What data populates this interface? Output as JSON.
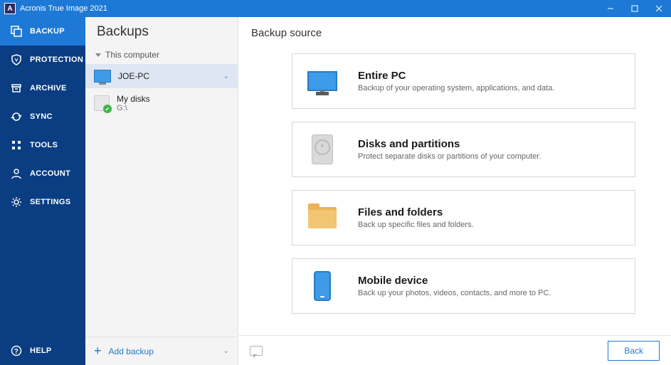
{
  "window": {
    "title": "Acronis True Image 2021",
    "logo_letter": "A"
  },
  "nav": {
    "items": [
      {
        "id": "backup",
        "label": "BACKUP"
      },
      {
        "id": "protection",
        "label": "PROTECTION"
      },
      {
        "id": "archive",
        "label": "ARCHIVE"
      },
      {
        "id": "sync",
        "label": "SYNC"
      },
      {
        "id": "tools",
        "label": "TOOLS"
      },
      {
        "id": "account",
        "label": "ACCOUNT"
      },
      {
        "id": "settings",
        "label": "SETTINGS"
      }
    ],
    "help_label": "HELP"
  },
  "panel": {
    "header": "Backups",
    "group_label": "This computer",
    "backups": [
      {
        "name": "JOE-PC",
        "sub": null,
        "selected": true,
        "icon": "monitor"
      },
      {
        "name": "My disks",
        "sub": "G:\\",
        "selected": false,
        "icon": "hdd"
      }
    ],
    "add_label": "Add backup"
  },
  "content": {
    "header": "Backup source",
    "options": [
      {
        "id": "entire-pc",
        "title": "Entire PC",
        "desc": "Backup of your operating system, applications, and data."
      },
      {
        "id": "disks",
        "title": "Disks and partitions",
        "desc": "Protect separate disks or partitions of your computer."
      },
      {
        "id": "files",
        "title": "Files and folders",
        "desc": "Back up specific files and folders."
      },
      {
        "id": "mobile",
        "title": "Mobile device",
        "desc": "Back up your photos, videos, contacts, and more to PC."
      }
    ]
  },
  "footer": {
    "back_label": "Back"
  }
}
